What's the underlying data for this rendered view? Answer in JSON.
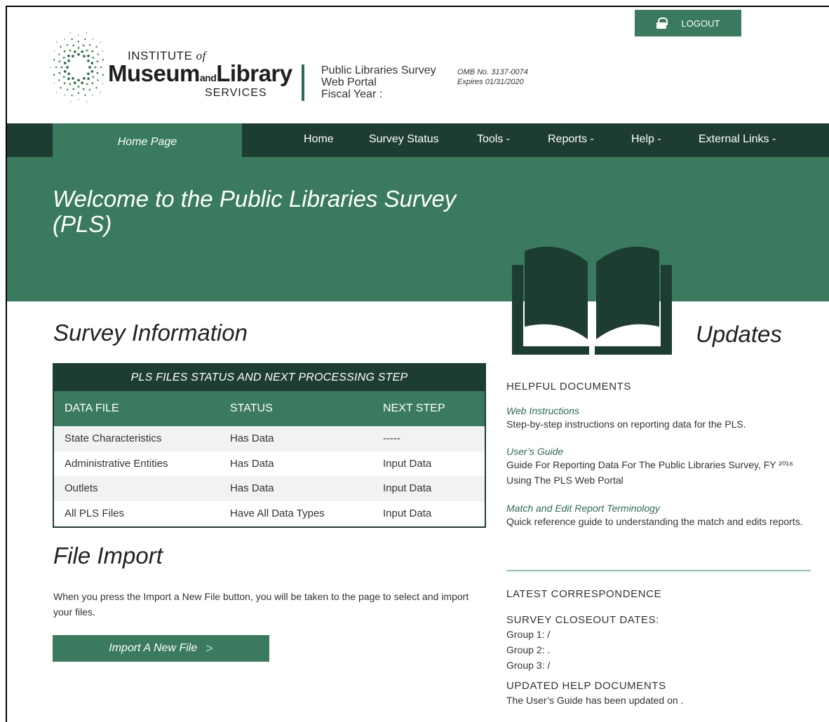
{
  "header": {
    "logo": {
      "institute": "INSTITUTE",
      "of": "of",
      "museum": "Museum",
      "and": "and",
      "library": "Library",
      "services": "SERVICES"
    },
    "portal_lines": [
      "Public Libraries Survey",
      "Web Portal",
      "Fiscal Year :"
    ],
    "omb_lines": [
      "OMB No. 3137-0074",
      "Expires 01/31/2020"
    ],
    "logout_label": "LOGOUT",
    "logout_icon": "lock-icon"
  },
  "nav": {
    "current": "Home Page",
    "items": [
      "Home",
      "Survey Status",
      "Tools -",
      "Reports -",
      "Help -",
      "External Links -"
    ]
  },
  "hero": {
    "title": "Welcome to the Public Libraries Survey (PLS)"
  },
  "survey": {
    "title": "Survey Information",
    "table": {
      "caption": "PLS FILES STATUS AND NEXT PROCESSING STEP",
      "columns": [
        "DATA FILE",
        "STATUS",
        "NEXT STEP"
      ],
      "rows": [
        [
          "State Characteristics",
          "Has Data",
          "-----"
        ],
        [
          "Administrative Entities",
          "Has Data",
          "Input Data"
        ],
        [
          "Outlets",
          "Has Data",
          "Input Data"
        ],
        [
          "All PLS Files",
          "Have All Data Types",
          "Input Data"
        ]
      ]
    }
  },
  "file_import": {
    "title": "File Import",
    "text": "When you press the Import a New File button, you will be taken to the page to select and import your files.",
    "button": "Import A New File",
    "button_chevron": ">"
  },
  "updates": {
    "title": "Updates",
    "helpful_heading": "HELPFUL DOCUMENTS",
    "docs": [
      {
        "link": "Web Instructions",
        "desc": "Step-by-step instructions on reporting data for the PLS."
      },
      {
        "link": "User’s Guide",
        "desc": "Guide For Reporting Data For The Public Libraries Survey, FY ²⁰¹⁶ Using The PLS Web Portal"
      },
      {
        "link": "Match and Edit Report Terminology",
        "desc": "Quick reference guide to understanding the match and edits reports."
      }
    ],
    "correspondence_heading": "LATEST CORRESPONDENCE",
    "closeout_heading": "SURVEY CLOSEOUT DATES:",
    "groups": [
      "Group 1: /",
      "Group 2: .",
      "Group 3: /"
    ],
    "help_heading": "UPDATED HELP DOCUMENTS",
    "help_text": "The User’s Guide has been updated on ."
  },
  "colors": {
    "dark_green": "#1e3d32",
    "green": "#3a7a5e",
    "accent_line": "#8fbfaa"
  }
}
